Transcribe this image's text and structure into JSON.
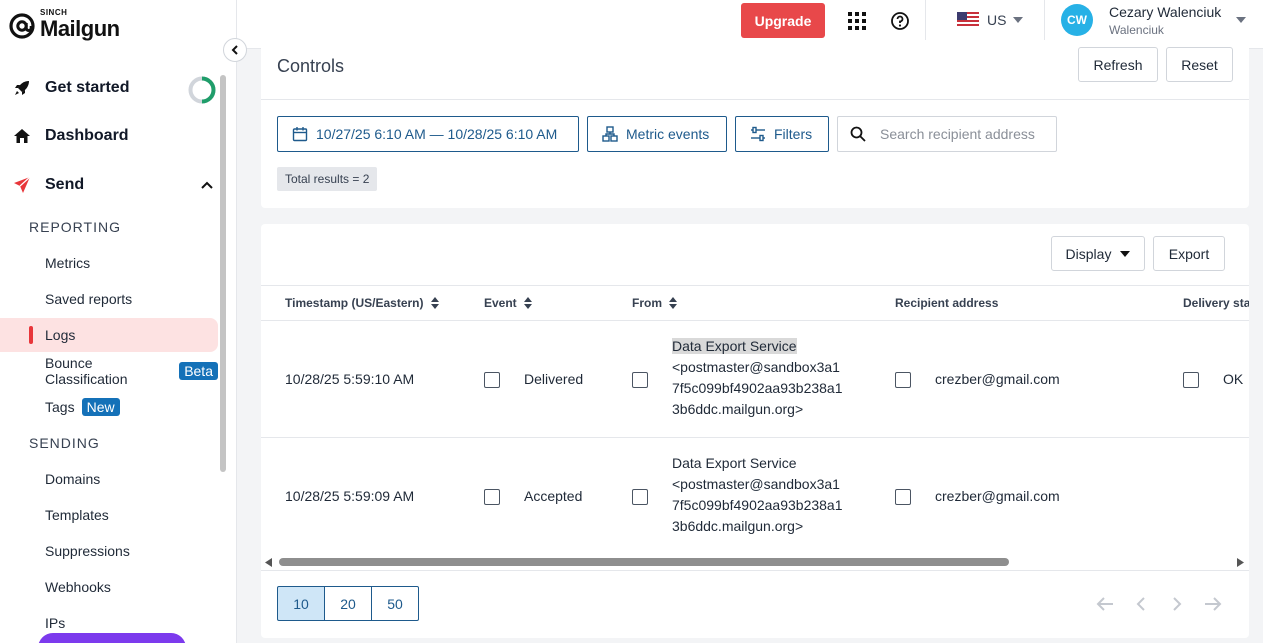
{
  "brand": {
    "sinch": "SINCH",
    "name": "Mailgun"
  },
  "sidebar": {
    "main": [
      {
        "label": "Get started",
        "icon": "rocket-icon"
      },
      {
        "label": "Dashboard",
        "icon": "home-icon"
      },
      {
        "label": "Send",
        "icon": "send-icon"
      }
    ],
    "reporting_label": "REPORTING",
    "reporting": [
      {
        "label": "Metrics"
      },
      {
        "label": "Saved reports"
      },
      {
        "label": "Logs",
        "active": true
      },
      {
        "label": "Bounce Classification",
        "badge": "Beta"
      },
      {
        "label": "Tags",
        "badge": "New"
      }
    ],
    "sending_label": "SENDING",
    "sending": [
      {
        "label": "Domains"
      },
      {
        "label": "Templates"
      },
      {
        "label": "Suppressions"
      },
      {
        "label": "Webhooks"
      },
      {
        "label": "IPs"
      }
    ]
  },
  "topbar": {
    "upgrade_label": "Upgrade",
    "region": "US",
    "user_initials": "CW",
    "user_name": "Cezary Walenciuk",
    "user_sub": "Walenciuk"
  },
  "controls": {
    "title": "Controls",
    "refresh_label": "Refresh",
    "reset_label": "Reset",
    "date_range": "10/27/25 6:10 AM — 10/28/25 6:10 AM",
    "metric_events_label": "Metric events",
    "filters_label": "Filters",
    "search_placeholder": "Search recipient address",
    "total_results": "Total results = 2"
  },
  "results": {
    "display_label": "Display",
    "export_label": "Export",
    "columns": {
      "timestamp": "Timestamp (US/Eastern)",
      "event": "Event",
      "from": "From",
      "recipient": "Recipient address",
      "delivery": "Delivery stat"
    },
    "rows": [
      {
        "timestamp": "10/28/25 5:59:10 AM",
        "event": "Delivered",
        "from_name": "Data Export Service",
        "from_line1": "<postmaster@sandbox3a1",
        "from_line2": "7f5c099bf4902aa93b238a1",
        "from_line3": "3b6ddc.mailgun.org>",
        "recipient": "crezber@gmail.com",
        "delivery": "OK"
      },
      {
        "timestamp": "10/28/25 5:59:09 AM",
        "event": "Accepted",
        "from_name": "Data Export Service",
        "from_line1": "<postmaster@sandbox3a1",
        "from_line2": "7f5c099bf4902aa93b238a1",
        "from_line3": "3b6ddc.mailgun.org>",
        "recipient": "crezber@gmail.com",
        "delivery": ""
      }
    ],
    "page_sizes": [
      "10",
      "20",
      "50"
    ],
    "selected_page_size": "10"
  },
  "colors": {
    "accent_red": "#e8484a",
    "link_blue": "#1e5a8c",
    "avatar": "#27b1e6"
  }
}
